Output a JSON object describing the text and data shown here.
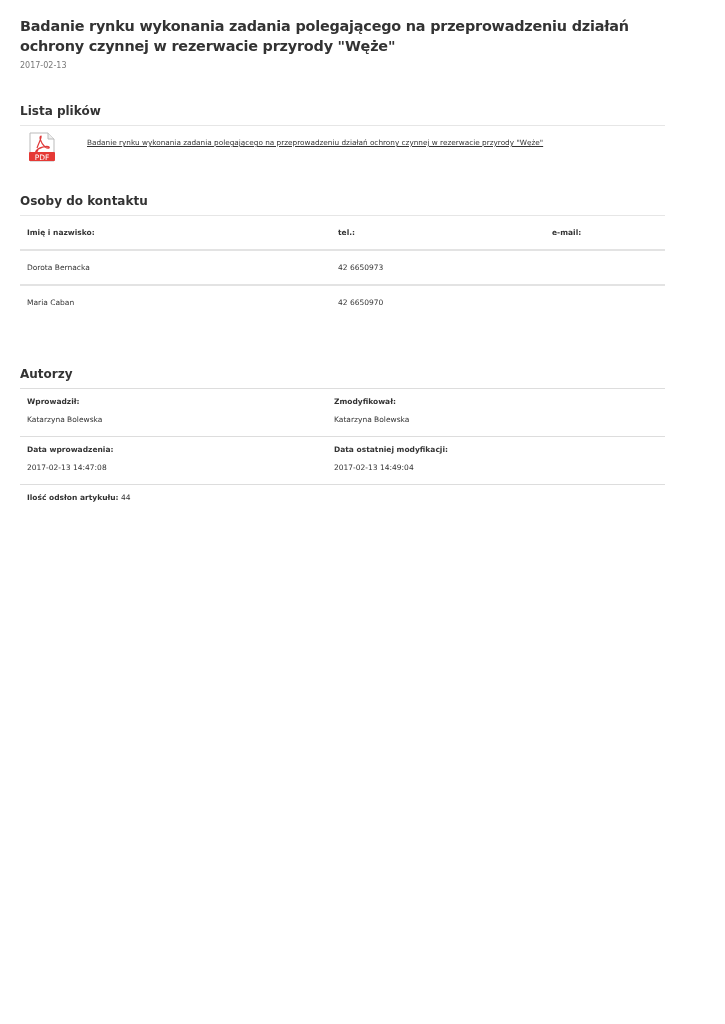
{
  "article": {
    "title": "Badanie rynku wykonania zadania polegającego na przeprowadzeniu działań ochrony czynnej w rezerwacie przyrody \"Węże\"",
    "date": "2017-02-13"
  },
  "files": {
    "heading": "Lista plików",
    "items": [
      {
        "icon_label": "PDF",
        "name": "Badanie rynku wykonania zadania polegającego na przeprowadzeniu działań ochrony czynnej w rezerwacie przyrody \"Węże\""
      }
    ]
  },
  "contacts": {
    "heading": "Osoby do kontaktu",
    "columns": [
      "Imię i nazwisko:",
      "tel.:",
      "e-mail:"
    ],
    "rows": [
      [
        "Dorota Bernacka",
        "42 6650973",
        ""
      ],
      [
        "Maria Caban",
        "42 6650970",
        ""
      ]
    ]
  },
  "authors": {
    "heading": "Autorzy",
    "rows": [
      [
        {
          "label": "Wprowadził:",
          "value": "Katarzyna Bolewska"
        },
        {
          "label": "Zmodyfikował:",
          "value": "Katarzyna Bolewska"
        }
      ],
      [
        {
          "label": "Data wprowadzenia:",
          "value": "2017-02-13 14:47:08"
        },
        {
          "label": "Data ostatniej modyfikacji:",
          "value": "2017-02-13 14:49:04"
        }
      ]
    ],
    "views": "**Ilość odsłon artykułu:** 44"
  }
}
